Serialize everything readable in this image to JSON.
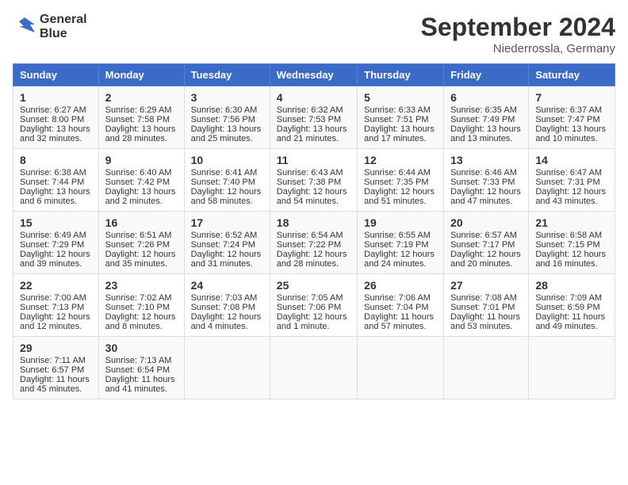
{
  "header": {
    "logo_line1": "General",
    "logo_line2": "Blue",
    "title": "September 2024",
    "subtitle": "Niederrossla, Germany"
  },
  "calendar": {
    "days_of_week": [
      "Sunday",
      "Monday",
      "Tuesday",
      "Wednesday",
      "Thursday",
      "Friday",
      "Saturday"
    ],
    "weeks": [
      [
        null,
        {
          "day": 2,
          "sunrise": "6:29 AM",
          "sunset": "7:58 PM",
          "daylight": "Daylight: 13 hours and 28 minutes."
        },
        {
          "day": 3,
          "sunrise": "6:30 AM",
          "sunset": "7:56 PM",
          "daylight": "Daylight: 13 hours and 25 minutes."
        },
        {
          "day": 4,
          "sunrise": "6:32 AM",
          "sunset": "7:53 PM",
          "daylight": "Daylight: 13 hours and 21 minutes."
        },
        {
          "day": 5,
          "sunrise": "6:33 AM",
          "sunset": "7:51 PM",
          "daylight": "Daylight: 13 hours and 17 minutes."
        },
        {
          "day": 6,
          "sunrise": "6:35 AM",
          "sunset": "7:49 PM",
          "daylight": "Daylight: 13 hours and 13 minutes."
        },
        {
          "day": 7,
          "sunrise": "6:37 AM",
          "sunset": "7:47 PM",
          "daylight": "Daylight: 13 hours and 10 minutes."
        }
      ],
      [
        {
          "day": 8,
          "sunrise": "6:38 AM",
          "sunset": "7:44 PM",
          "daylight": "Daylight: 13 hours and 6 minutes."
        },
        {
          "day": 9,
          "sunrise": "6:40 AM",
          "sunset": "7:42 PM",
          "daylight": "Daylight: 13 hours and 2 minutes."
        },
        {
          "day": 10,
          "sunrise": "6:41 AM",
          "sunset": "7:40 PM",
          "daylight": "Daylight: 12 hours and 58 minutes."
        },
        {
          "day": 11,
          "sunrise": "6:43 AM",
          "sunset": "7:38 PM",
          "daylight": "Daylight: 12 hours and 54 minutes."
        },
        {
          "day": 12,
          "sunrise": "6:44 AM",
          "sunset": "7:35 PM",
          "daylight": "Daylight: 12 hours and 51 minutes."
        },
        {
          "day": 13,
          "sunrise": "6:46 AM",
          "sunset": "7:33 PM",
          "daylight": "Daylight: 12 hours and 47 minutes."
        },
        {
          "day": 14,
          "sunrise": "6:47 AM",
          "sunset": "7:31 PM",
          "daylight": "Daylight: 12 hours and 43 minutes."
        }
      ],
      [
        {
          "day": 15,
          "sunrise": "6:49 AM",
          "sunset": "7:29 PM",
          "daylight": "Daylight: 12 hours and 39 minutes."
        },
        {
          "day": 16,
          "sunrise": "6:51 AM",
          "sunset": "7:26 PM",
          "daylight": "Daylight: 12 hours and 35 minutes."
        },
        {
          "day": 17,
          "sunrise": "6:52 AM",
          "sunset": "7:24 PM",
          "daylight": "Daylight: 12 hours and 31 minutes."
        },
        {
          "day": 18,
          "sunrise": "6:54 AM",
          "sunset": "7:22 PM",
          "daylight": "Daylight: 12 hours and 28 minutes."
        },
        {
          "day": 19,
          "sunrise": "6:55 AM",
          "sunset": "7:19 PM",
          "daylight": "Daylight: 12 hours and 24 minutes."
        },
        {
          "day": 20,
          "sunrise": "6:57 AM",
          "sunset": "7:17 PM",
          "daylight": "Daylight: 12 hours and 20 minutes."
        },
        {
          "day": 21,
          "sunrise": "6:58 AM",
          "sunset": "7:15 PM",
          "daylight": "Daylight: 12 hours and 16 minutes."
        }
      ],
      [
        {
          "day": 22,
          "sunrise": "7:00 AM",
          "sunset": "7:13 PM",
          "daylight": "Daylight: 12 hours and 12 minutes."
        },
        {
          "day": 23,
          "sunrise": "7:02 AM",
          "sunset": "7:10 PM",
          "daylight": "Daylight: 12 hours and 8 minutes."
        },
        {
          "day": 24,
          "sunrise": "7:03 AM",
          "sunset": "7:08 PM",
          "daylight": "Daylight: 12 hours and 4 minutes."
        },
        {
          "day": 25,
          "sunrise": "7:05 AM",
          "sunset": "7:06 PM",
          "daylight": "Daylight: 12 hours and 1 minute."
        },
        {
          "day": 26,
          "sunrise": "7:06 AM",
          "sunset": "7:04 PM",
          "daylight": "Daylight: 11 hours and 57 minutes."
        },
        {
          "day": 27,
          "sunrise": "7:08 AM",
          "sunset": "7:01 PM",
          "daylight": "Daylight: 11 hours and 53 minutes."
        },
        {
          "day": 28,
          "sunrise": "7:09 AM",
          "sunset": "6:59 PM",
          "daylight": "Daylight: 11 hours and 49 minutes."
        }
      ],
      [
        {
          "day": 29,
          "sunrise": "7:11 AM",
          "sunset": "6:57 PM",
          "daylight": "Daylight: 11 hours and 45 minutes."
        },
        {
          "day": 30,
          "sunrise": "7:13 AM",
          "sunset": "6:54 PM",
          "daylight": "Daylight: 11 hours and 41 minutes."
        },
        null,
        null,
        null,
        null,
        null
      ]
    ],
    "week0_sun": {
      "day": 1,
      "sunrise": "6:27 AM",
      "sunset": "8:00 PM",
      "daylight": "Daylight: 13 hours and 32 minutes."
    }
  }
}
